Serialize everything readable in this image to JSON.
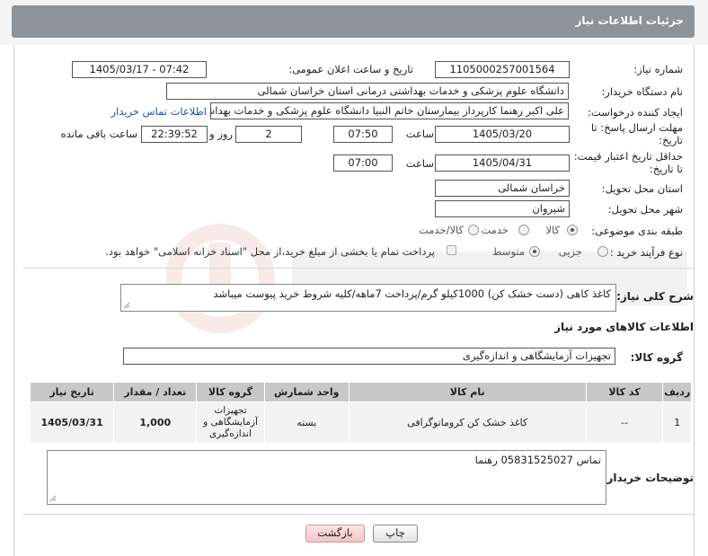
{
  "header": {
    "title": "جزئیات اطلاعات نیاز"
  },
  "form": {
    "need_number_label": "شماره نیاز:",
    "need_number": "1105000257001564",
    "announce_label": "تاریخ و ساعت اعلان عمومی:",
    "announce_value": "1405/03/17 - 07:42",
    "buyer_org_label": "نام دستگاه خریدار:",
    "buyer_org": "دانشگاه علوم پزشکی و خدمات بهداشتی درمانی استان خراسان شمالی",
    "requester_label": "ایجاد کننده درخواست:",
    "requester": "علی اکبر رهنما کارپرداز بیمارستان خاتم النبیا دانشگاه علوم پزشکی و خدمات بهداشتی",
    "contact_link": "اطلاعات تماس خریدار",
    "deadline_label_1": "مهلت ارسال پاسخ: تا",
    "deadline_label_2": "تاریخ:",
    "deadline_date": "1405/03/20",
    "time_word": "ساعت",
    "deadline_time": "07:50",
    "days_value": "2",
    "days_word": "روز و",
    "remaining_time": "22:39:52",
    "remaining_word": "ساعت باقی مانده",
    "min_validity_label_1": "حداقل تاریخ اعتبار قیمت:",
    "min_validity_label_2": "تا تاریخ:",
    "validity_date": "1405/04/31",
    "validity_time": "07:00",
    "province_label": "استان محل تحویل:",
    "province": "خراسان شمالی",
    "city_label": "شهر محل تحویل:",
    "city": "شیروان",
    "category_label": "طبقه بندی موضوعی:",
    "category_options": [
      "کالا",
      "خدمت",
      "کالا/خدمت"
    ],
    "process_label": "نوع فرآیند خرید :",
    "process_options": [
      "جزیی",
      "متوسط"
    ],
    "payment_note": "پرداخت تمام یا بخشی از مبلغ خرید،از محل \"اسناد خزانه اسلامی\" خواهد بود.",
    "general_desc_label": "شرح کلی نیاز:",
    "general_desc": "کاغذ کاهی (دست خشک کن) 1000کیلو گرم/پرداخت 7ماهه/کلیه شروط خرید پیوست میباشد"
  },
  "goods": {
    "section_title": "اطلاعات کالاهای مورد نیاز",
    "group_label": "گروه کالا:",
    "group_value": "تجهیزات آزمایشگاهی و اندازه‌گیری",
    "columns": [
      "ردیف",
      "کد کالا",
      "نام کالا",
      "واحد شمارش",
      "گروه کالا",
      "تعداد / مقدار",
      "تاریخ نیاز"
    ],
    "rows": [
      {
        "row": "1",
        "code": "--",
        "name": "کاغذ خشک کن کروماتوگرافی",
        "unit": "بسته",
        "group": "تجهیزات آزمایشگاهی و اندازه‌گیری",
        "quantity": "1,000",
        "date": "1405/03/31"
      }
    ]
  },
  "buyer_notes": {
    "label": "توضیحات خریدار:",
    "value": "تماس 05831525027 رهنما"
  },
  "buttons": {
    "print": "چاپ",
    "back": "بازگشت"
  },
  "colors": {
    "header_tab": "#8d9399",
    "link": "#1a55b0",
    "table_header": "#c8c8c8",
    "back_button": "#f2c6c6"
  }
}
